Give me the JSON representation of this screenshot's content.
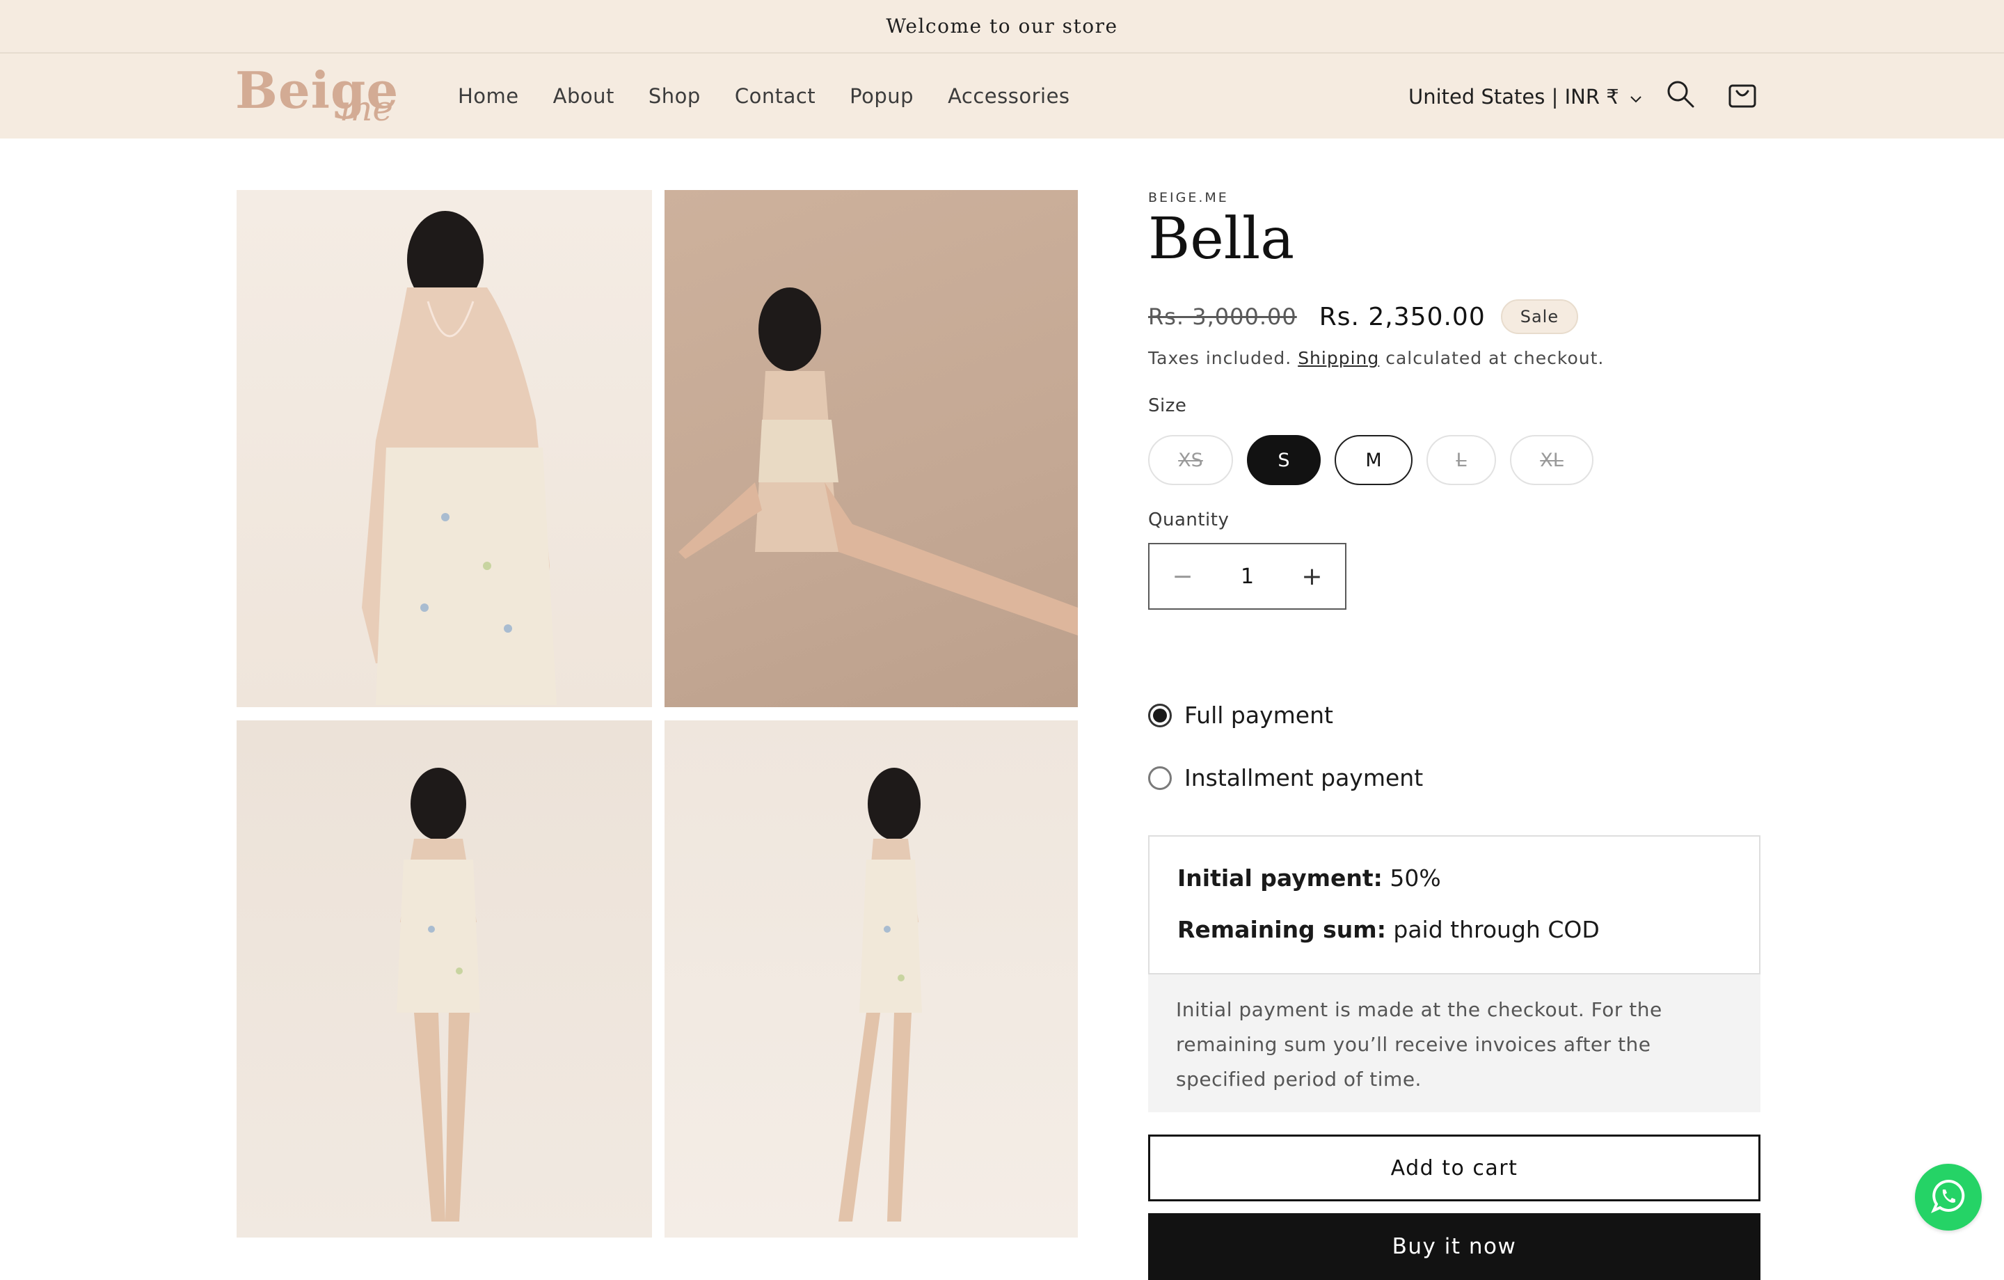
{
  "announcement": {
    "text": "Welcome to our store"
  },
  "logo": {
    "line1": "Beige",
    "line2": "me"
  },
  "nav": [
    {
      "label": "Home"
    },
    {
      "label": "About"
    },
    {
      "label": "Shop"
    },
    {
      "label": "Contact"
    },
    {
      "label": "Popup"
    },
    {
      "label": "Accessories"
    }
  ],
  "header": {
    "locale_label": "United States | INR ₹",
    "search_icon": "search-icon",
    "cart_icon": "cart-icon"
  },
  "gallery": [
    {
      "name": "product-image-back-view"
    },
    {
      "name": "product-image-seated"
    },
    {
      "name": "product-image-front-view"
    },
    {
      "name": "product-image-side-view"
    }
  ],
  "product": {
    "vendor": "BEIGE.ME",
    "title": "Bella",
    "compare_price": "Rs. 3,000.00",
    "price": "Rs. 2,350.00",
    "badge": "Sale",
    "tax_prefix": "Taxes included.",
    "tax_link": "Shipping",
    "tax_suffix": "calculated at checkout.",
    "size_label": "Size",
    "sizes": [
      {
        "label": "XS",
        "state": "unavailable"
      },
      {
        "label": "S",
        "state": "selected"
      },
      {
        "label": "M",
        "state": "available"
      },
      {
        "label": "L",
        "state": "unavailable"
      },
      {
        "label": "XL",
        "state": "unavailable"
      }
    ],
    "quantity_label": "Quantity",
    "quantity": "1",
    "minus": "−",
    "plus": "+"
  },
  "payment": {
    "options": [
      {
        "label": "Full payment",
        "selected": true
      },
      {
        "label": "Installment payment",
        "selected": false
      }
    ],
    "initial_label": "Initial payment:",
    "initial_value": "50%",
    "remaining_label": "Remaining sum:",
    "remaining_value": "paid through COD",
    "note": "Initial payment is made at the checkout. For the remaining sum you’ll receive invoices after the specified period of time."
  },
  "actions": {
    "add_to_cart": "Add to cart",
    "buy_now": "Buy it now"
  },
  "colors": {
    "header_bg": "#f5ebe0",
    "logo": "#d3ab94",
    "primary": "#121212",
    "whatsapp": "#25d366"
  }
}
